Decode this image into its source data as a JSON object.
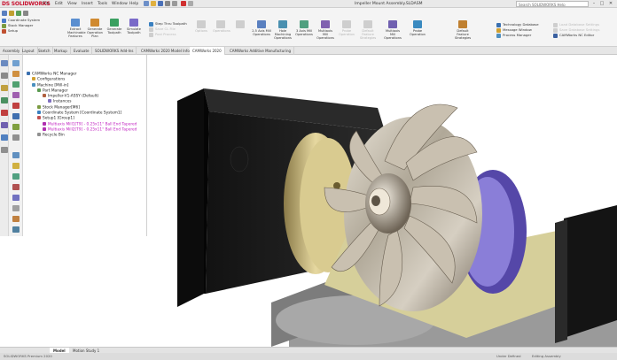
{
  "app": {
    "logo_prefix": "DS",
    "logo_text": "SOLIDWORKS",
    "menus": [
      "File",
      "Edit",
      "View",
      "Insert",
      "Tools",
      "Window",
      "Help"
    ],
    "document_title": "Impeller Mount Assembly.SLDASM",
    "search_placeholder": "Search SOLIDWORKS Help",
    "window_controls": [
      "–",
      "□",
      "✕"
    ]
  },
  "ribbon": {
    "left_small": [
      "Coordinate System",
      "Stock Manager",
      "Setup"
    ],
    "buttons": [
      {
        "label": "Extract Machinable Features",
        "icon": "extract-features-icon",
        "dim": false
      },
      {
        "label": "Generate Operation Plan",
        "icon": "operation-plan-icon",
        "dim": false
      },
      {
        "label": "Generate Toolpath",
        "icon": "toolpath-icon",
        "dim": false
      },
      {
        "label": "Simulate Toolpath",
        "icon": "simulate-icon",
        "dim": false
      }
    ],
    "step_small": [
      "Step Thru Toolpath",
      "Save CL File",
      "Post Process"
    ],
    "dim_buttons": [
      "Options",
      "Operations",
      "2.5 Axis Mill Operations",
      "Hole Machining Operations",
      "3 Axis Mill Operations",
      "Multiaxis Mill Operations",
      "Probe Operation",
      "Default Feature Strategies",
      "Multiaxis Mill Operations",
      "Probe Operation",
      "Default Feature Strategies"
    ],
    "right_small": [
      "Technology Database",
      "Message Window",
      "Process Manager"
    ],
    "far_right_small": [
      "Load Database Settings",
      "Save Database Settings",
      "CAMWorks NC Editor"
    ]
  },
  "tabs": [
    "Assembly",
    "Layout",
    "Sketch",
    "Markup",
    "Evaluate",
    "SOLIDWORKS Add-Ins",
    "CAMWorks 2020 Model Info",
    "CAMWorks 2020",
    "CAMWorks Additive Manufacturing"
  ],
  "active_tab_index": 7,
  "tree": [
    {
      "label": "CAMWorks NC Manager",
      "indent": 0,
      "magenta": false
    },
    {
      "label": "Configurations",
      "indent": 1,
      "magenta": false
    },
    {
      "label": "Machine [Mill-in]",
      "indent": 1,
      "magenta": false
    },
    {
      "label": "Part Manager",
      "indent": 2,
      "magenta": false
    },
    {
      "label": "Impeller-V1-ASSY (Default)",
      "indent": 3,
      "magenta": false
    },
    {
      "label": "Instances",
      "indent": 4,
      "magenta": false
    },
    {
      "label": "Stock Manager[M6]",
      "indent": 2,
      "magenta": false
    },
    {
      "label": "Coordinate System [Coordinate System1]",
      "indent": 2,
      "magenta": false
    },
    {
      "label": "Setup1 [Group1]",
      "indent": 2,
      "magenta": false
    },
    {
      "label": "Multiaxis Mill1[T9] - 0.25x11° Ball End Tapered",
      "indent": 3,
      "magenta": true
    },
    {
      "label": "Multiaxis Mill2[T9] - 0.25x11° Ball End Tapered",
      "indent": 3,
      "magenta": true
    },
    {
      "label": "Recycle Bin",
      "indent": 2,
      "magenta": false
    }
  ],
  "bottom_tabs": [
    "Model",
    "Motion Study 1"
  ],
  "active_bottom_tab": 0,
  "status": {
    "left": "SOLIDWORKS Premium 2020",
    "right_1": "Under Defined",
    "right_2": "Editing Assembly"
  },
  "colors": {
    "accent_red": "#c8102e",
    "tree_magenta": "#c020c0",
    "fixture_black": "#1c1c1c",
    "impeller_metal": "#b8b0a4",
    "brass": "#d8c890",
    "purple_ring": "#6b5fc0"
  }
}
